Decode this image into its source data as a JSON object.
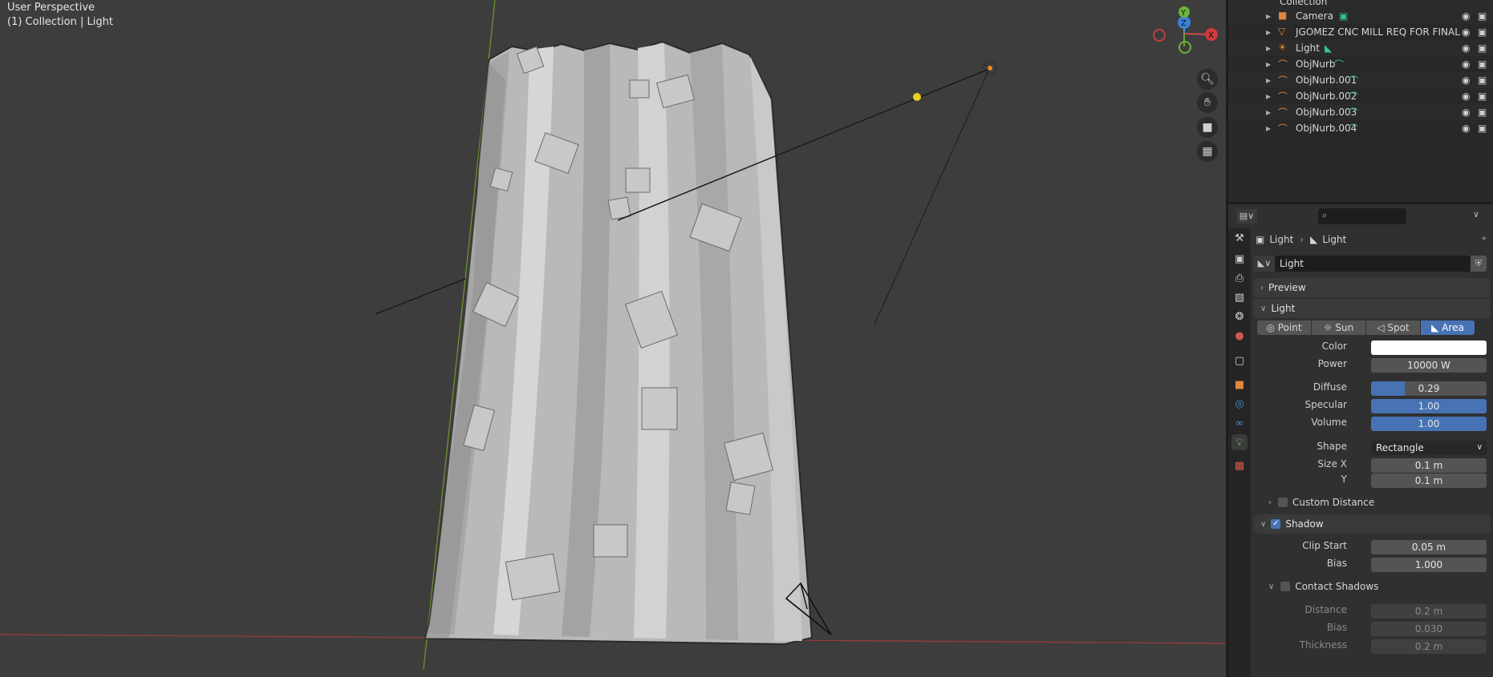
{
  "viewport": {
    "perspective_label": "User Perspective",
    "context_label": "(1) Collection | Light",
    "gizmo": {
      "x": "X",
      "y": "Y",
      "z": "Z"
    }
  },
  "outliner": {
    "collection_label": "Collection",
    "rows": [
      {
        "name": "Camera",
        "icon": "camera-icon",
        "color": "#e0883c"
      },
      {
        "name": "JGOMEZ CNC MILL REQ FOR FINAL",
        "icon": "mesh-icon",
        "color": "#e0883c"
      },
      {
        "name": "Light",
        "icon": "light-icon",
        "color": "#e0883c"
      },
      {
        "name": "ObjNurb",
        "icon": "curve-icon",
        "color": "#e0883c"
      },
      {
        "name": "ObjNurb.001",
        "icon": "curve-icon",
        "color": "#e0883c"
      },
      {
        "name": "ObjNurb.002",
        "icon": "curve-icon",
        "color": "#e0883c"
      },
      {
        "name": "ObjNurb.003",
        "icon": "curve-icon",
        "color": "#e0883c"
      },
      {
        "name": "ObjNurb.004",
        "icon": "curve-icon",
        "color": "#e0883c"
      }
    ]
  },
  "properties": {
    "breadcrumb": {
      "object": "Light",
      "data": "Light"
    },
    "datablock_name": "Light",
    "panels": {
      "preview": "Preview",
      "light": "Light",
      "custom_distance": "Custom Distance",
      "shadow": "Shadow",
      "contact_shadows": "Contact Shadows"
    },
    "light_types": [
      "Point",
      "Sun",
      "Spot",
      "Area"
    ],
    "active_light_type": "Area",
    "color_label": "Color",
    "color_value": "#ffffff",
    "power_label": "Power",
    "power": "10000 W",
    "diffuse_label": "Diffuse",
    "diffuse": "0.29",
    "diffuse_fraction": 0.29,
    "specular_label": "Specular",
    "specular": "1.00",
    "volume_label": "Volume",
    "volume": "1.00",
    "shape_label": "Shape",
    "shape": "Rectangle",
    "size_x_label": "Size X",
    "size_x": "0.1 m",
    "size_y_label": "Y",
    "size_y": "0.1 m",
    "clip_start_label": "Clip Start",
    "clip_start": "0.05 m",
    "bias_label": "Bias",
    "bias": "1.000",
    "contact": {
      "distance_label": "Distance",
      "distance": "0.2 m",
      "bias_label": "Bias",
      "bias": "0.030",
      "thickness_label": "Thickness",
      "thickness": "0.2 m"
    }
  }
}
